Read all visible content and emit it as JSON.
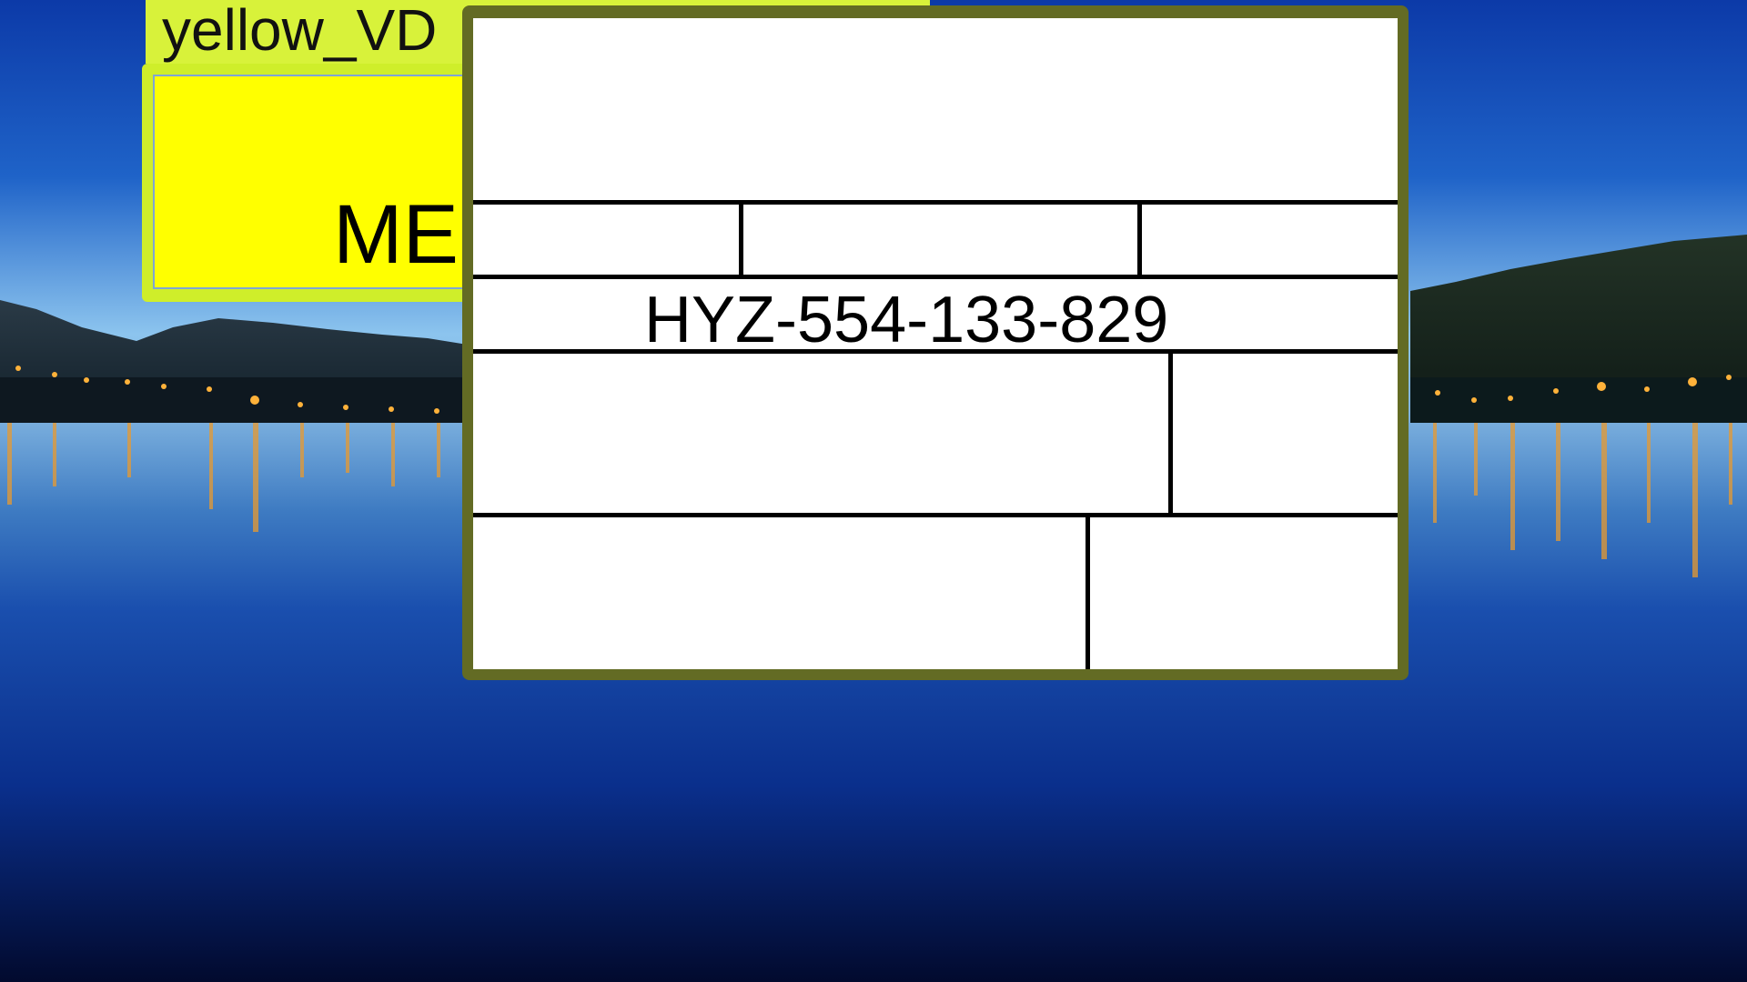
{
  "desktop": {
    "wallpaper": "night-lake-wallpaper",
    "colors": {
      "sky_top": "#0b3fb4",
      "sky_horizon": "#8fc6f0",
      "water_bottom": "#020a2e",
      "lights": "#ffb23a"
    }
  },
  "yellow_window": {
    "title": "yellow_VDK_label_...",
    "title_visible": "yellow_VD",
    "message": "MES",
    "colors": {
      "titlebar": "#d8f23a",
      "panel": "#ffff00"
    }
  },
  "form_window": {
    "id_code": "HYZ-554-133-829",
    "colors": {
      "frame": "#636b24",
      "background": "#ffffff",
      "lines": "#000000"
    }
  }
}
